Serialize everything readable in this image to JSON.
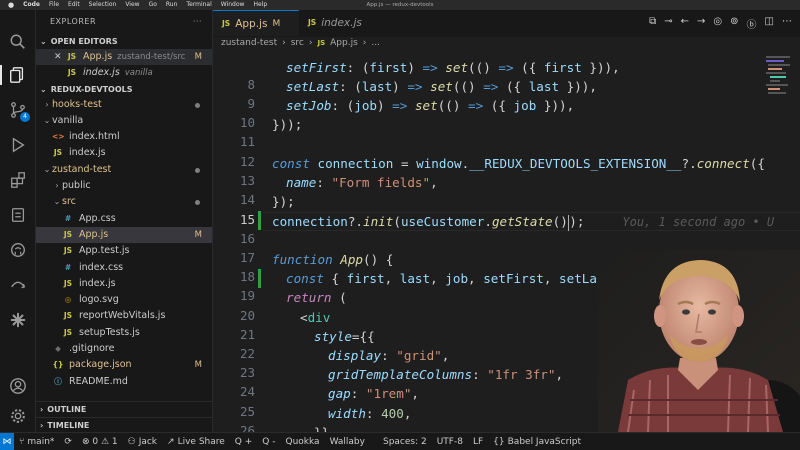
{
  "menubar": {
    "items": [
      "Code",
      "File",
      "Edit",
      "Selection",
      "View",
      "Go",
      "Run",
      "Terminal",
      "Window",
      "Help"
    ],
    "window_title": "App.js — redux-devtools"
  },
  "activity_bar": {
    "source_control_badge": "4"
  },
  "sidebar": {
    "title": "EXPLORER",
    "more": "···",
    "open_editors_label": "OPEN EDITORS",
    "open_editors": [
      {
        "name": "App.js",
        "path": "zustand-test/src",
        "status": "M",
        "icon": "JS"
      },
      {
        "name": "index.js",
        "path": "vanilla",
        "status": "",
        "icon": "JS"
      }
    ],
    "project_label": "REDUX-DEVTOOLS",
    "tree": [
      {
        "name": "hooks-test",
        "icon": "",
        "chev": "›",
        "indent": 1
      },
      {
        "name": "vanilla",
        "icon": "",
        "chev": "⌄",
        "indent": 1
      },
      {
        "name": "index.html",
        "icon": "<>",
        "chev": "",
        "indent": 2
      },
      {
        "name": "index.js",
        "icon": "JS",
        "chev": "",
        "indent": 2
      },
      {
        "name": "zustand-test",
        "icon": "",
        "chev": "⌄",
        "indent": 1
      },
      {
        "name": "public",
        "icon": "",
        "chev": "›",
        "indent": 2
      },
      {
        "name": "src",
        "icon": "",
        "chev": "⌄",
        "indent": 2
      },
      {
        "name": "App.css",
        "icon": "#",
        "chev": "",
        "indent": 3
      },
      {
        "name": "App.js",
        "icon": "JS",
        "chev": "",
        "indent": 3,
        "status": "M"
      },
      {
        "name": "App.test.js",
        "icon": "JS",
        "chev": "",
        "indent": 3
      },
      {
        "name": "index.css",
        "icon": "#",
        "chev": "",
        "indent": 3
      },
      {
        "name": "index.js",
        "icon": "JS",
        "chev": "",
        "indent": 3
      },
      {
        "name": "logo.svg",
        "icon": "◎",
        "chev": "",
        "indent": 3
      },
      {
        "name": "reportWebVitals.js",
        "icon": "JS",
        "chev": "",
        "indent": 3
      },
      {
        "name": "setupTests.js",
        "icon": "JS",
        "chev": "",
        "indent": 3
      },
      {
        "name": ".gitignore",
        "icon": "◆",
        "chev": "",
        "indent": 2
      },
      {
        "name": "package.json",
        "icon": "{}",
        "chev": "",
        "indent": 2,
        "status": "M"
      },
      {
        "name": "README.md",
        "icon": "ⓘ",
        "chev": "",
        "indent": 2
      }
    ],
    "outline_label": "OUTLINE",
    "timeline_label": "TIMELINE"
  },
  "tabs": [
    {
      "icon": "JS",
      "label": "App.js",
      "status": "M"
    },
    {
      "icon": "JS",
      "label": "index.js",
      "status": ""
    }
  ],
  "breadcrumb": [
    "zustand-test",
    "src",
    "App.js",
    "..."
  ],
  "editor": {
    "line_numbers": [
      "",
      "8",
      "9",
      "10",
      "11",
      "12",
      "13",
      "14",
      "15",
      "16",
      "17",
      "18",
      "19",
      "20",
      "21",
      "22",
      "23",
      "24",
      "25",
      "26"
    ],
    "current_line": "15",
    "blame": "You, 1 second ago • U",
    "lines": [
      "setFirst: (first) => set(() => ({ first })),",
      "setLast: (last) => set(() => ({ last })),",
      "setJob: (job) => set(() => ({ job })),",
      "}));",
      "",
      "const connection = window.__REDUX_DEVTOOLS_EXTENSION__?.connect({",
      "name: \"Form fields\",",
      "});",
      "connection?.init(useCustomer.getState());",
      "",
      "function App() {",
      "const { first, last, job, setFirst, setLast, setJob } = use",
      "return (",
      "<div",
      "style={{",
      "display: \"grid\",",
      "gridTemplateColumns: \"1fr 3fr\",",
      "gap: \"1rem\",",
      "width: 400,",
      "}}"
    ]
  },
  "status_bar": {
    "branch": "main*",
    "sync": "⟳",
    "problems": "⊗ 0 ⚠ 1",
    "user": "Jack",
    "live_share": "Live Share",
    "q_plus": "Q +",
    "q_minus": "Q -",
    "quokka": "Quokka",
    "wallaby": "Wallaby",
    "spaces": "Spaces: 2",
    "encoding": "UTF-8",
    "eol": "LF",
    "language": "Babel JavaScript"
  }
}
